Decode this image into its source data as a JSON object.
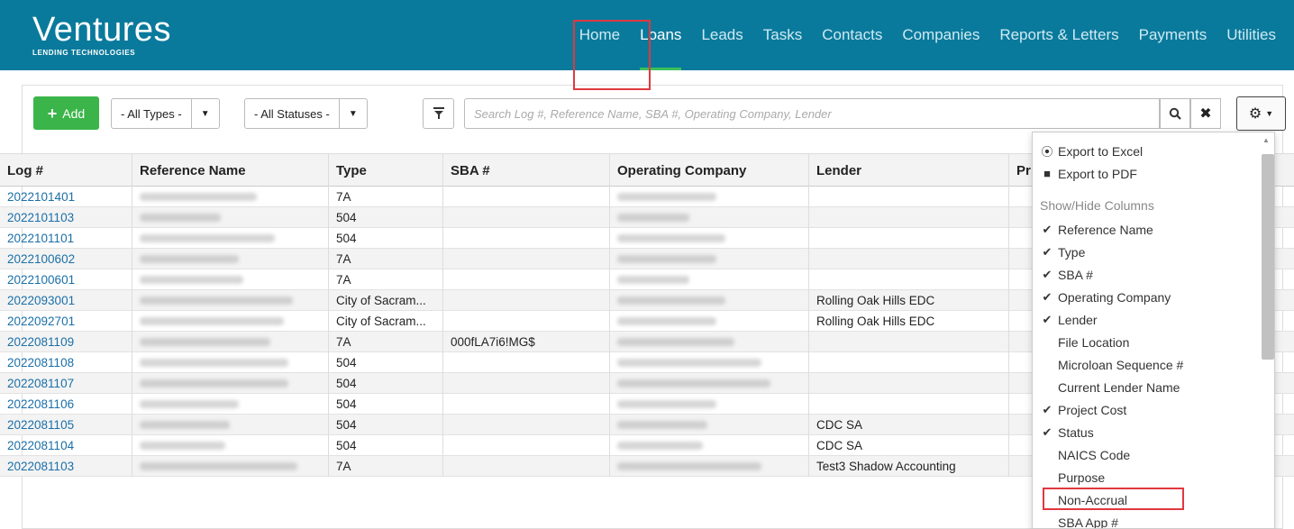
{
  "brand": {
    "name": "Ventures",
    "tagline": "LENDING TECHNOLOGIES"
  },
  "nav": {
    "items": [
      "Home",
      "Loans",
      "Leads",
      "Tasks",
      "Contacts",
      "Companies",
      "Reports & Letters",
      "Payments",
      "Utilities"
    ],
    "active": "Loans"
  },
  "toolbar": {
    "add_label": "Add",
    "types_label": "- All Types -",
    "statuses_label": "- All Statuses -",
    "search_placeholder": "Search Log #, Reference Name, SBA #, Operating Company, Lender"
  },
  "table": {
    "columns": [
      "Log #",
      "Reference Name",
      "Type",
      "SBA #",
      "Operating Company",
      "Lender",
      "Pr"
    ],
    "rows": [
      {
        "log": "2022101401",
        "type": "7A",
        "sba": "",
        "lender": ""
      },
      {
        "log": "2022101103",
        "type": "504",
        "sba": "",
        "lender": ""
      },
      {
        "log": "2022101101",
        "type": "504",
        "sba": "",
        "lender": ""
      },
      {
        "log": "2022100602",
        "type": "7A",
        "sba": "",
        "lender": ""
      },
      {
        "log": "2022100601",
        "type": "7A",
        "sba": "",
        "lender": ""
      },
      {
        "log": "2022093001",
        "type": "City of Sacram...",
        "sba": "",
        "lender": "Rolling Oak Hills EDC"
      },
      {
        "log": "2022092701",
        "type": "City of Sacram...",
        "sba": "",
        "lender": "Rolling Oak Hills EDC"
      },
      {
        "log": "2022081109",
        "type": "7A",
        "sba": "000fLA7i6!MG$",
        "lender": ""
      },
      {
        "log": "2022081108",
        "type": "504",
        "sba": "",
        "lender": ""
      },
      {
        "log": "2022081107",
        "type": "504",
        "sba": "",
        "lender": ""
      },
      {
        "log": "2022081106",
        "type": "504",
        "sba": "",
        "lender": ""
      },
      {
        "log": "2022081105",
        "type": "504",
        "sba": "",
        "lender": "CDC SA"
      },
      {
        "log": "2022081104",
        "type": "504",
        "sba": "",
        "lender": "CDC SA"
      },
      {
        "log": "2022081103",
        "type": "7A",
        "sba": "",
        "lender": "Test3 Shadow Accounting"
      }
    ]
  },
  "menu": {
    "export_excel": "Export to Excel",
    "export_pdf": "Export to PDF",
    "section": "Show/Hide Columns",
    "columns": [
      {
        "label": "Reference Name",
        "checked": true
      },
      {
        "label": "Type",
        "checked": true
      },
      {
        "label": "SBA #",
        "checked": true
      },
      {
        "label": "Operating Company",
        "checked": true
      },
      {
        "label": "Lender",
        "checked": true
      },
      {
        "label": "File Location",
        "checked": false
      },
      {
        "label": "Microloan Sequence #",
        "checked": false
      },
      {
        "label": "Current Lender Name",
        "checked": false
      },
      {
        "label": "Project Cost",
        "checked": true
      },
      {
        "label": "Status",
        "checked": true
      },
      {
        "label": "NAICS Code",
        "checked": false
      },
      {
        "label": "Purpose",
        "checked": false
      },
      {
        "label": "Non-Accrual",
        "checked": false
      },
      {
        "label": "SBA App #",
        "checked": false
      }
    ]
  },
  "colors": {
    "header": "#0a7a9c",
    "add": "#3bb54a",
    "link": "#1a6fa8",
    "highlight": "#e0393f"
  }
}
